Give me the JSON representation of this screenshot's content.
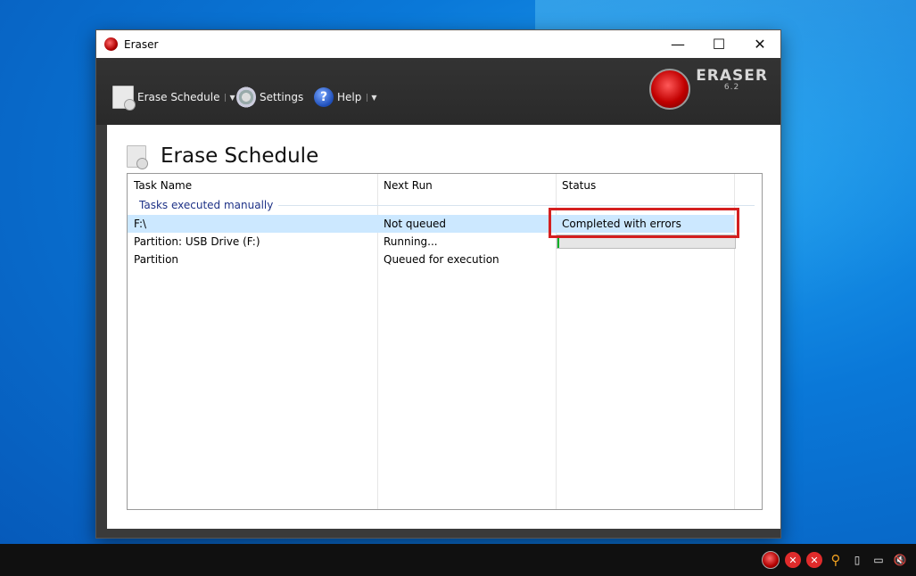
{
  "window": {
    "title": "Eraser",
    "minimize": "—",
    "maximize": "☐",
    "close": "✕"
  },
  "toolbar": {
    "erase_schedule": "Erase Schedule",
    "settings": "Settings",
    "help": "Help",
    "help_glyph": "?",
    "dropdown_glyph": "▼",
    "logo_name": "ERASER",
    "logo_version": "6.2"
  },
  "page": {
    "title": "Erase Schedule"
  },
  "list": {
    "columns": [
      "Task Name",
      "Next Run",
      "Status"
    ],
    "group": "Tasks executed manually",
    "rows": [
      {
        "name": "F:\\",
        "next_run": "Not queued",
        "status": "Completed with errors"
      },
      {
        "name": "Partition: USB Drive (F:)",
        "next_run": "Running...",
        "status": ""
      },
      {
        "name": "Partition",
        "next_run": "Queued for execution",
        "status": ""
      }
    ],
    "running_progress": 0.01
  },
  "tray": {
    "icons": [
      "eraser-icon",
      "error-icon",
      "error-icon",
      "search-icon",
      "usb-icon",
      "network-icon",
      "mute-icon"
    ],
    "x_glyph": "✕",
    "mute_glyph": "🔇",
    "usb_glyph": "▯",
    "net_glyph": "▭",
    "search_glyph": "⚲"
  },
  "colors": {
    "highlight": "#d42020",
    "selection": "#cce8ff",
    "progress": "#06b025"
  }
}
